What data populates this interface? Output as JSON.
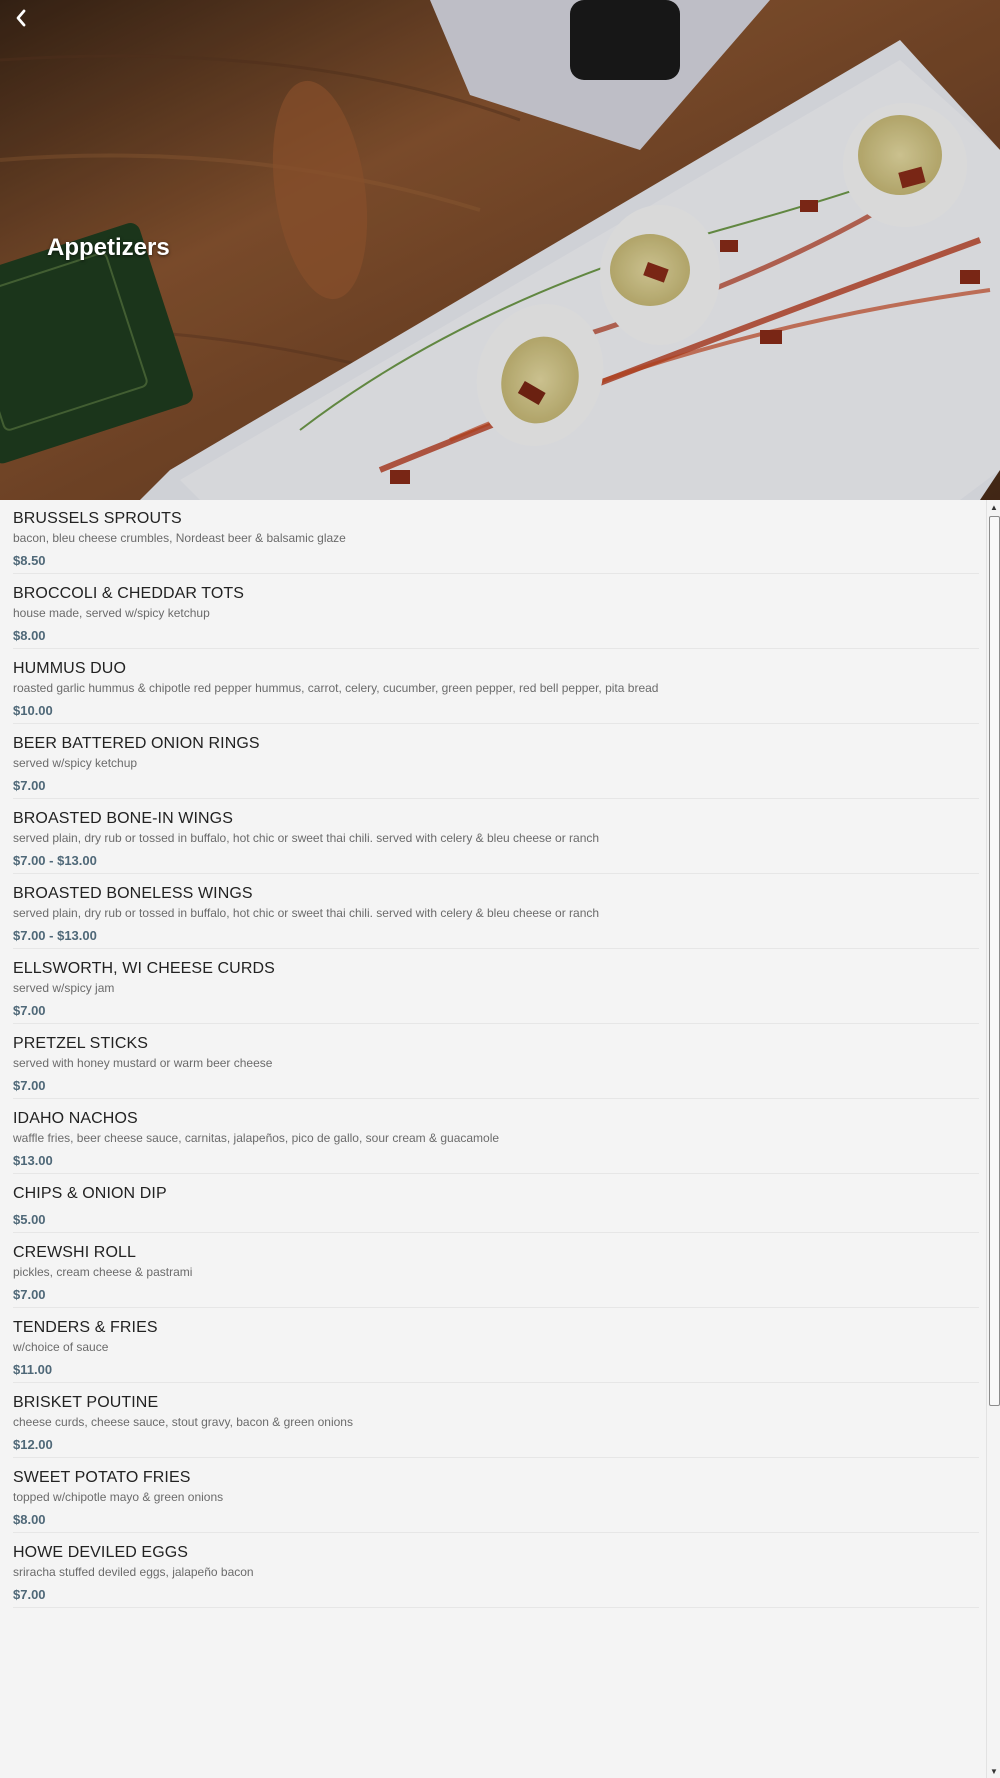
{
  "header": {
    "title": "Appetizers",
    "back_icon": "chevron-left-icon",
    "image": "deviled-eggs-photo"
  },
  "items": [
    {
      "name": "BRUSSELS SPROUTS",
      "desc": "bacon, bleu cheese crumbles, Nordeast beer & balsamic glaze",
      "price": "$8.50"
    },
    {
      "name": "BROCCOLI & CHEDDAR TOTS",
      "desc": "house made, served w/spicy ketchup",
      "price": "$8.00"
    },
    {
      "name": "HUMMUS DUO",
      "desc": "roasted garlic hummus & chipotle red pepper hummus, carrot, celery, cucumber, green pepper, red bell pepper, pita bread",
      "price": "$10.00"
    },
    {
      "name": "BEER BATTERED ONION RINGS",
      "desc": "served w/spicy ketchup",
      "price": "$7.00"
    },
    {
      "name": "BROASTED BONE-IN WINGS",
      "desc": "served plain, dry rub or tossed in buffalo, hot chic or sweet thai chili. served with celery & bleu cheese or ranch",
      "price": "$7.00 - $13.00"
    },
    {
      "name": "BROASTED BONELESS WINGS",
      "desc": "served plain, dry rub or tossed in buffalo, hot chic or sweet thai chili. served with celery & bleu cheese or ranch",
      "price": "$7.00 - $13.00"
    },
    {
      "name": "ELLSWORTH, WI CHEESE CURDS",
      "desc": "served w/spicy jam",
      "price": "$7.00"
    },
    {
      "name": "PRETZEL STICKS",
      "desc": "served with honey mustard or warm beer cheese",
      "price": "$7.00"
    },
    {
      "name": "IDAHO NACHOS",
      "desc": "waffle fries, beer cheese sauce, carnitas, jalapeños, pico de gallo, sour cream & guacamole",
      "price": "$13.00"
    },
    {
      "name": "CHIPS & ONION DIP",
      "desc": "",
      "price": "$5.00"
    },
    {
      "name": "CREWSHI ROLL",
      "desc": "pickles, cream cheese & pastrami",
      "price": "$7.00"
    },
    {
      "name": "TENDERS & FRIES",
      "desc": "w/choice of sauce",
      "price": "$11.00"
    },
    {
      "name": "BRISKET POUTINE",
      "desc": "cheese curds, cheese sauce, stout gravy, bacon & green onions",
      "price": "$12.00"
    },
    {
      "name": "SWEET POTATO FRIES",
      "desc": "topped w/chipotle mayo & green onions",
      "price": "$8.00"
    },
    {
      "name": "HOWE DEVILED EGGS",
      "desc": "sriracha stuffed deviled eggs, jalapeño bacon",
      "price": "$7.00"
    }
  ],
  "colors": {
    "background": "#f4f4f4",
    "item_name": "#222222",
    "item_desc": "#6b6b6b",
    "price": "#4f6878"
  }
}
